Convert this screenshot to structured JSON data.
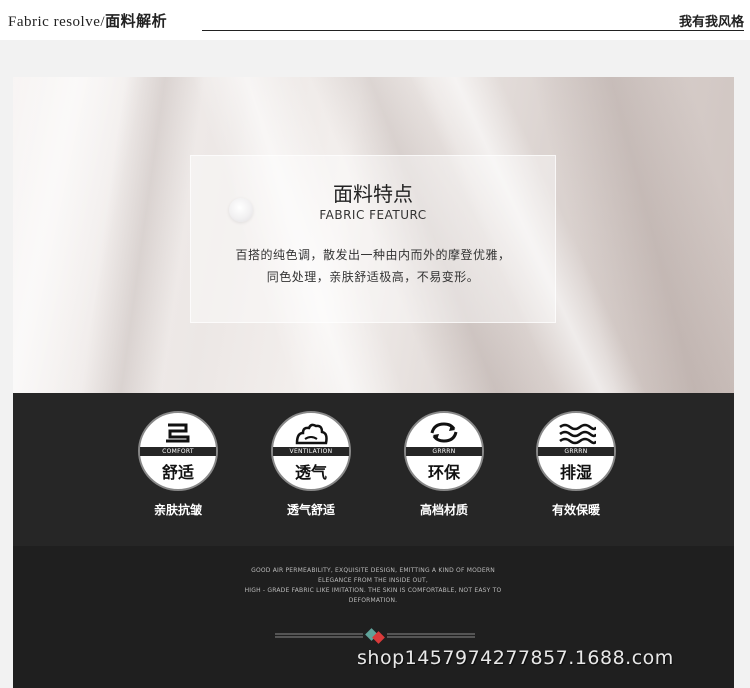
{
  "header": {
    "title_en": "Fabric resolve/",
    "title_cn": "面料解析",
    "slogan": "我有我风格"
  },
  "panel": {
    "title": "面料特点",
    "subtitle": "FABRIC FEATURC",
    "desc_line1": "百搭的纯色调，散发出一种由内而外的摩登优雅，",
    "desc_line2": "同色处理，亲肤舒适极高，不易变形。"
  },
  "features": [
    {
      "band": "COMFORT",
      "name": "舒适",
      "caption": "亲肤抗皱",
      "icon": "comfort-icon"
    },
    {
      "band": "VENTILATION",
      "name": "透气",
      "caption": "透气舒适",
      "icon": "ventilation-icon"
    },
    {
      "band": "GRRRN",
      "name": "环保",
      "caption": "高档材质",
      "icon": "recycle-icon"
    },
    {
      "band": "GRRRN",
      "name": "排湿",
      "caption": "有效保暖",
      "icon": "waves-icon"
    }
  ],
  "bottom_text": {
    "line1": "GOOD AIR PERMEABILITY, EXQUISITE DESIGN, EMITTING A KIND OF MODERN",
    "line2": "ELEGANCE FROM THE INSIDE OUT,",
    "line3": "HIGH - GRADE FABRIC LIKE IMITATION. THE SKIN IS COMFORTABLE, NOT EASY TO",
    "line4": "DEFORMATION."
  },
  "watermark": "shop1457974277857.1688.com",
  "colors": {
    "dark_band": "#262626",
    "ornament_red": "#d93a3a",
    "ornament_teal": "#5fa39a"
  }
}
